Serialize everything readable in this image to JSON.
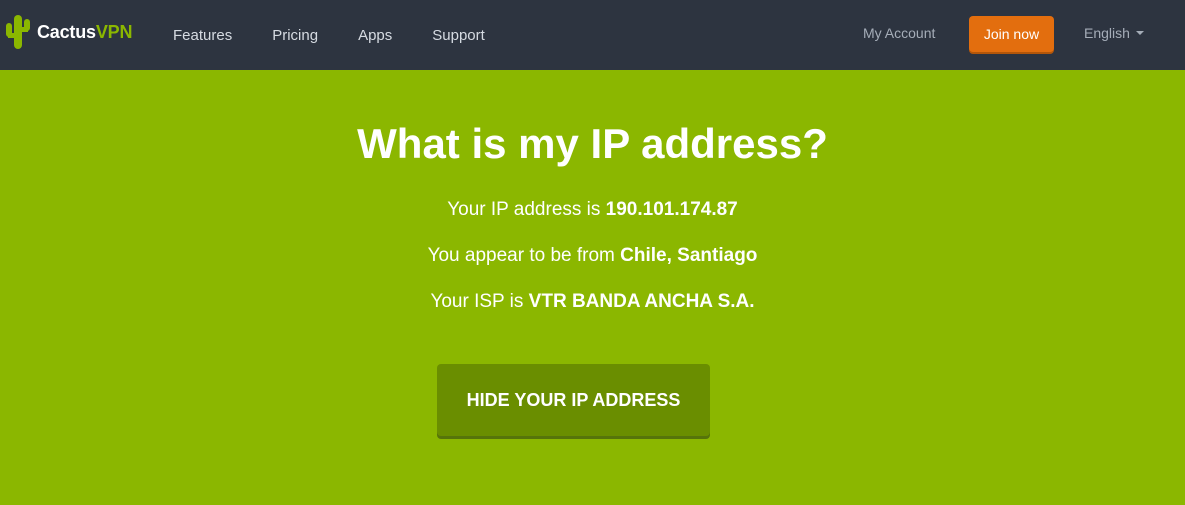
{
  "brand": {
    "name_part1": "Cactus",
    "name_part2": "VPN",
    "logo_icon": "cactus-icon"
  },
  "nav": {
    "links": [
      "Features",
      "Pricing",
      "Apps",
      "Support"
    ],
    "my_account": "My Account",
    "join_now": "Join now",
    "language": "English"
  },
  "hero": {
    "title": "What is my IP address?",
    "ip_label": "Your IP address is",
    "ip_value": "190.101.174.87",
    "location_label": "You appear to be from",
    "location_value": "Chile, Santiago",
    "isp_label": "Your ISP is",
    "isp_value": "VTR BANDA ANCHA S.A.",
    "cta": "HIDE YOUR IP ADDRESS"
  },
  "colors": {
    "navbar_bg": "#2d3440",
    "hero_bg": "#8bb700",
    "accent_orange": "#e36e0e",
    "cta_bg": "#6a8e00"
  }
}
